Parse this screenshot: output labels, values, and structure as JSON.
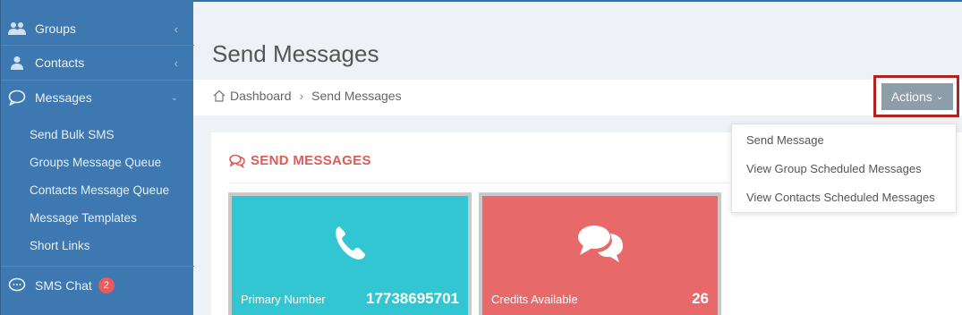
{
  "sidebar": {
    "items": [
      {
        "label": "Groups",
        "icon": "users-icon"
      },
      {
        "label": "Contacts",
        "icon": "user-icon"
      },
      {
        "label": "Messages",
        "icon": "speech-bubble-icon"
      },
      {
        "label": "SMS Chat",
        "icon": "chat-icon",
        "badge": "2"
      }
    ],
    "submenu": [
      "Send Bulk SMS",
      "Groups Message Queue",
      "Contacts Message Queue",
      "Message Templates",
      "Short Links"
    ]
  },
  "header": {
    "title": "Send Messages"
  },
  "breadcrumb": {
    "home": "Dashboard",
    "current": "Send Messages"
  },
  "actions": {
    "label": "Actions",
    "menu": [
      "Send Message",
      "View Group Scheduled Messages",
      "View Contacts Scheduled Messages"
    ]
  },
  "panel": {
    "title": "SEND MESSAGES",
    "stats": [
      {
        "label": "Primary Number",
        "value": "17738695701",
        "icon": "phone-icon",
        "color": "#32c5d2"
      },
      {
        "label": "Credits Available",
        "value": "26",
        "icon": "chat-bubbles-icon",
        "color": "#e7696a"
      }
    ]
  },
  "colors": {
    "sidebar": "#3d78b0",
    "accent_red": "#e05a5a",
    "highlight_border": "#b22222",
    "actions_button": "#8d9ea9"
  }
}
